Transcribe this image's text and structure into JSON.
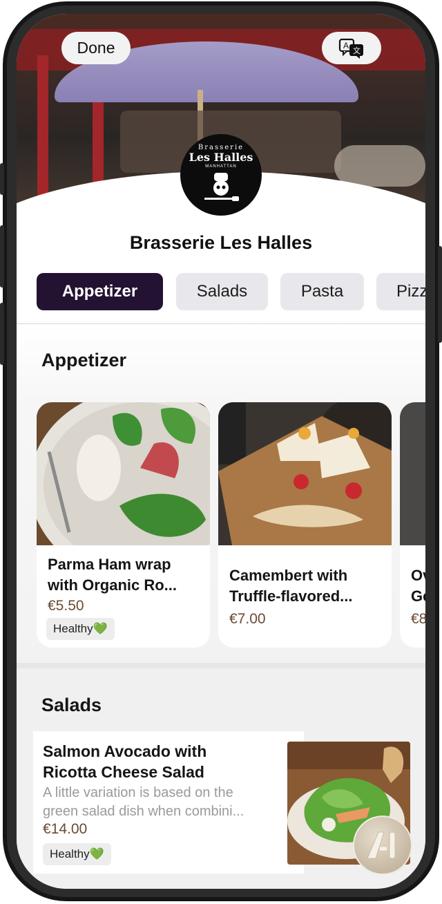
{
  "header": {
    "done_label": "Done",
    "translate_icon": "translate-icon",
    "logo_text": {
      "line1": "Brasserie",
      "line2": "Les Halles",
      "line3": "MANHATTAN"
    }
  },
  "restaurant": {
    "name": "Brasserie Les Halles"
  },
  "tabs": [
    {
      "label": "Appetizer",
      "active": true
    },
    {
      "label": "Salads",
      "active": false
    },
    {
      "label": "Pasta",
      "active": false
    },
    {
      "label": "Pizz",
      "active": false
    }
  ],
  "sections": {
    "appetizer": {
      "title": "Appetizer",
      "items": [
        {
          "name_line1": "Parma Ham wrap",
          "name_line2": "with Organic Ro...",
          "price": "€5.50",
          "tag": "Healthy💚"
        },
        {
          "name_line1": "Camembert with",
          "name_line2": "Truffle-flavored...",
          "price": "€7.00"
        },
        {
          "name_line1": "Ov",
          "name_line2": "Ge",
          "price": "€8"
        }
      ]
    },
    "salads": {
      "title": "Salads",
      "items": [
        {
          "name_line1": "Salmon Avocado with",
          "name_line2": "Ricotta Cheese Salad",
          "desc_line1": "A little variation is based on the",
          "desc_line2": "green salad dish when combini...",
          "price": "€14.00",
          "tag": "Healthy💚"
        }
      ]
    }
  },
  "assistant": {
    "icon": "ai-assistant-icon"
  },
  "colors": {
    "active_tab": "#241232",
    "price": "#6a4a34",
    "tag_bg": "#ededed"
  }
}
